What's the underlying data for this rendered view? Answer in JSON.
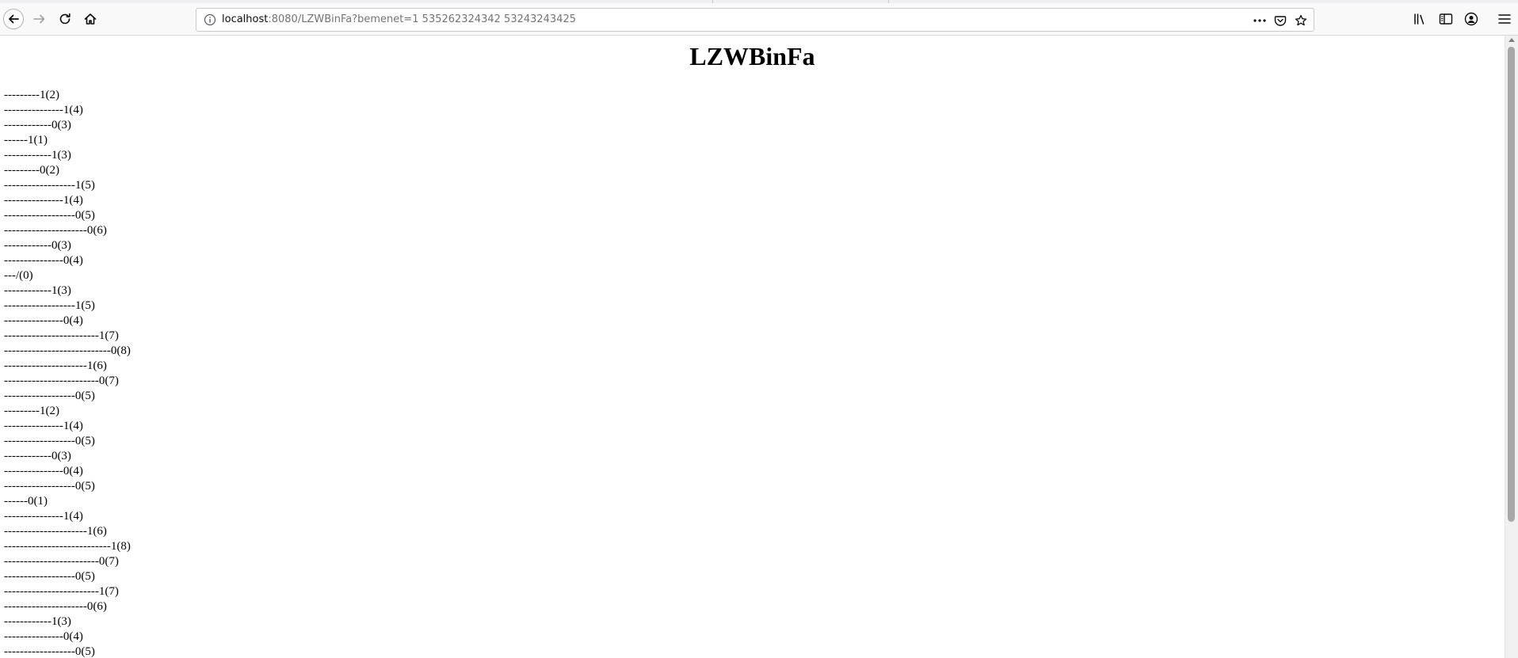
{
  "browser": {
    "url_host": "localhost",
    "url_rest": ":8080/LZWBinFa?bemenet=1 535262324342 53243243425",
    "icons": {
      "back": "back-arrow-icon",
      "forward": "forward-arrow-icon",
      "reload": "reload-icon",
      "home": "home-icon",
      "info": "info-icon",
      "more": "more-dots-icon",
      "pocket": "pocket-icon",
      "bookmark": "star-icon",
      "library": "library-icon",
      "sidebar": "sidebar-icon",
      "account": "account-icon",
      "menu": "hamburger-menu-icon"
    }
  },
  "page": {
    "title": "LZWBinFa",
    "tree_lines": [
      "---------1(2)",
      "---------------1(4)",
      "------------0(3)",
      "------1(1)",
      "------------1(3)",
      "---------0(2)",
      "------------------1(5)",
      "---------------1(4)",
      "------------------0(5)",
      "---------------------0(6)",
      "------------0(3)",
      "---------------0(4)",
      "---/(0)",
      "------------1(3)",
      "------------------1(5)",
      "---------------0(4)",
      "------------------------1(7)",
      "---------------------------0(8)",
      "---------------------1(6)",
      "------------------------0(7)",
      "------------------0(5)",
      "---------1(2)",
      "---------------1(4)",
      "------------------0(5)",
      "------------0(3)",
      "---------------0(4)",
      "------------------0(5)",
      "------0(1)",
      "---------------1(4)",
      "---------------------1(6)",
      "---------------------------1(8)",
      "------------------------0(7)",
      "------------------0(5)",
      "------------------------1(7)",
      "---------------------0(6)",
      "------------1(3)",
      "---------------0(4)",
      "------------------0(5)"
    ]
  }
}
